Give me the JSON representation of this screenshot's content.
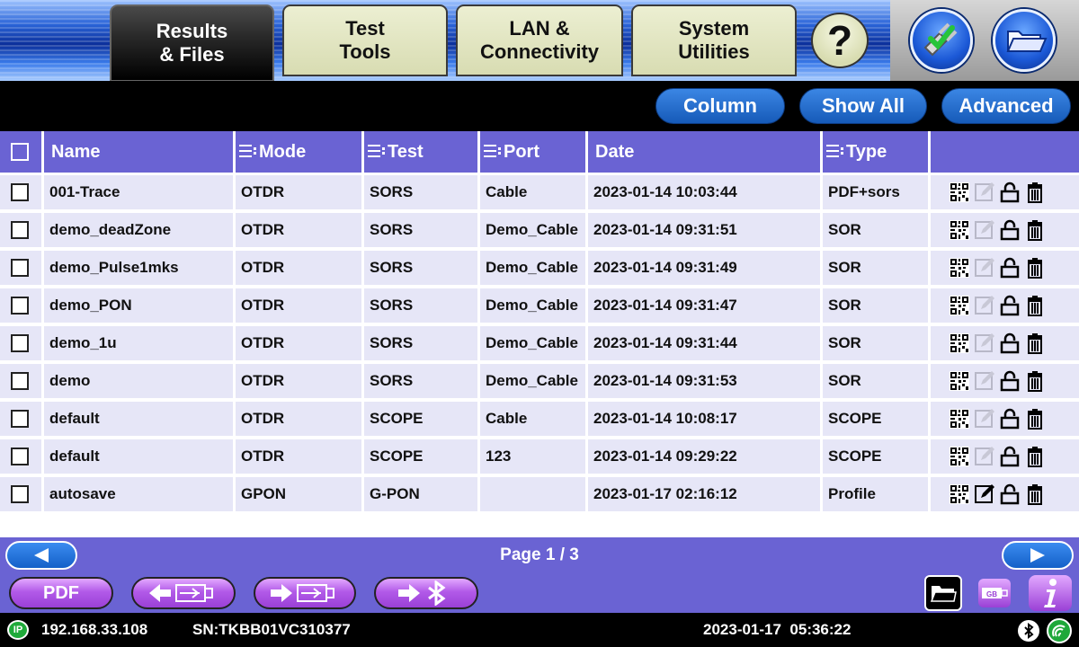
{
  "tabs": [
    {
      "label": "Results\n& Files",
      "active": true
    },
    {
      "label": "Test\nTools",
      "active": false
    },
    {
      "label": "LAN &\nConnectivity",
      "active": false
    },
    {
      "label": "System\nUtilities",
      "active": false
    }
  ],
  "help_label": "?",
  "toolbar": {
    "column": "Column",
    "show_all": "Show All",
    "advanced": "Advanced"
  },
  "columns": {
    "name": "Name",
    "mode": "Mode",
    "test": "Test",
    "port": "Port",
    "date": "Date",
    "type": "Type"
  },
  "rows": [
    {
      "name": "001-Trace",
      "mode": "OTDR",
      "test": "SORS",
      "port": "Cable",
      "date": "2023-01-14 10:03:44",
      "type": "PDF+sors"
    },
    {
      "name": "demo_deadZone",
      "mode": "OTDR",
      "test": "SORS",
      "port": "Demo_Cable",
      "date": "2023-01-14 09:31:51",
      "type": "SOR"
    },
    {
      "name": "demo_Pulse1mks",
      "mode": "OTDR",
      "test": "SORS",
      "port": "Demo_Cable",
      "date": "2023-01-14 09:31:49",
      "type": "SOR"
    },
    {
      "name": "demo_PON",
      "mode": "OTDR",
      "test": "SORS",
      "port": "Demo_Cable",
      "date": "2023-01-14 09:31:47",
      "type": "SOR"
    },
    {
      "name": "demo_1u",
      "mode": "OTDR",
      "test": "SORS",
      "port": "Demo_Cable",
      "date": "2023-01-14 09:31:44",
      "type": "SOR"
    },
    {
      "name": "demo",
      "mode": "OTDR",
      "test": "SORS",
      "port": "Demo_Cable",
      "date": "2023-01-14 09:31:53",
      "type": "SOR"
    },
    {
      "name": "default",
      "mode": "OTDR",
      "test": "SCOPE",
      "port": "Cable",
      "date": "2023-01-14 10:08:17",
      "type": "SCOPE"
    },
    {
      "name": "default",
      "mode": "OTDR",
      "test": "SCOPE",
      "port": "123",
      "date": "2023-01-14 09:29:22",
      "type": "SCOPE"
    },
    {
      "name": "autosave",
      "mode": "GPON",
      "test": "G-PON",
      "port": "",
      "date": "2023-01-17 02:16:12",
      "type": "Profile"
    }
  ],
  "pager": {
    "text": "Page 1 / 3"
  },
  "actions": {
    "pdf": "PDF"
  },
  "status": {
    "ip_badge": "IP",
    "ip": "192.168.33.108",
    "serial": "SN:TKBB01VC310377",
    "datetime": "2023-01-17  05:36:22"
  },
  "colors": {
    "header": "#6a63d3",
    "row": "#e6e6f7",
    "accent_blue": "#1b58d6",
    "purple_button": "#b25ae8"
  }
}
